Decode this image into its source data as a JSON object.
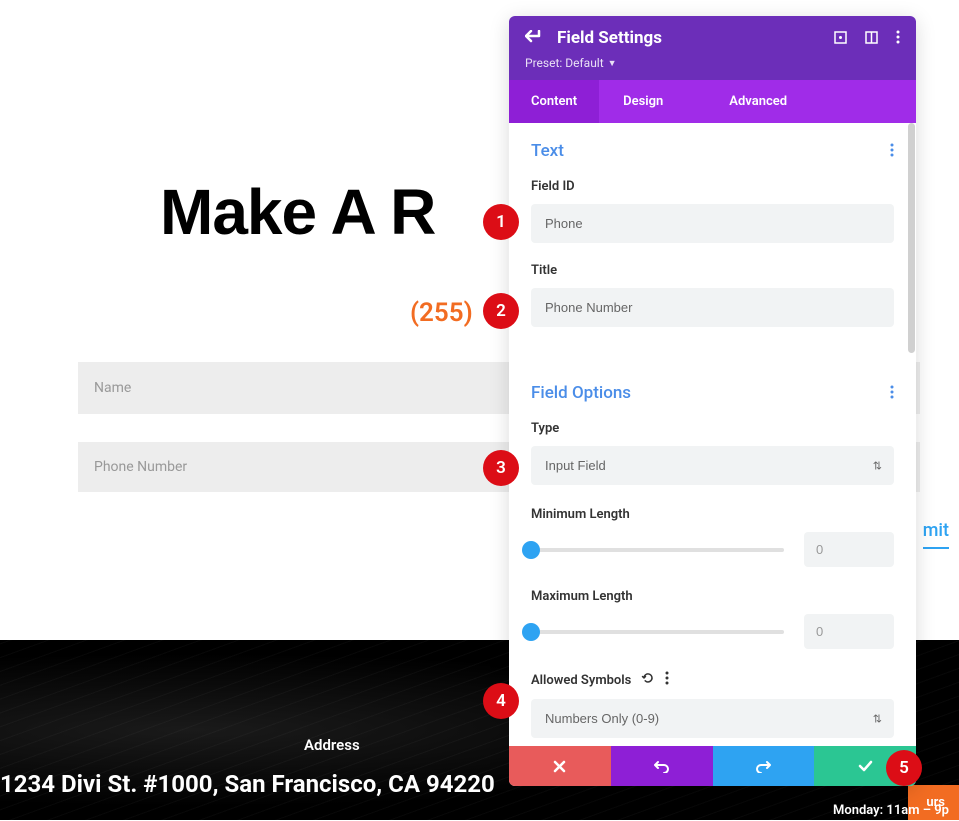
{
  "hero": {
    "title": "Make A R",
    "phone": "(255)"
  },
  "form": {
    "name_placeholder": "Name",
    "phone_placeholder": "Phone Number",
    "submit": "mit"
  },
  "footer": {
    "addr_label": "Address",
    "addr_text": "1234 Divi St. #1000, San Francisco, CA 94220",
    "hours_label": "urs",
    "hours_text": "Monday: 11am – 9p"
  },
  "panel": {
    "title": "Field Settings",
    "preset_label": "Preset: Default",
    "tabs": {
      "content": "Content",
      "design": "Design",
      "advanced": "Advanced"
    },
    "sections": {
      "text": {
        "title": "Text",
        "field_id_label": "Field ID",
        "field_id_value": "Phone",
        "title_label": "Title",
        "title_value": "Phone Number"
      },
      "options": {
        "title": "Field Options",
        "type_label": "Type",
        "type_value": "Input Field",
        "min_label": "Minimum Length",
        "min_value": "0",
        "max_label": "Maximum Length",
        "max_value": "0",
        "allowed_label": "Allowed Symbols",
        "allowed_value": "Numbers Only (0-9)"
      }
    }
  },
  "anno": {
    "1": "1",
    "2": "2",
    "3": "3",
    "4": "4",
    "5": "5"
  }
}
